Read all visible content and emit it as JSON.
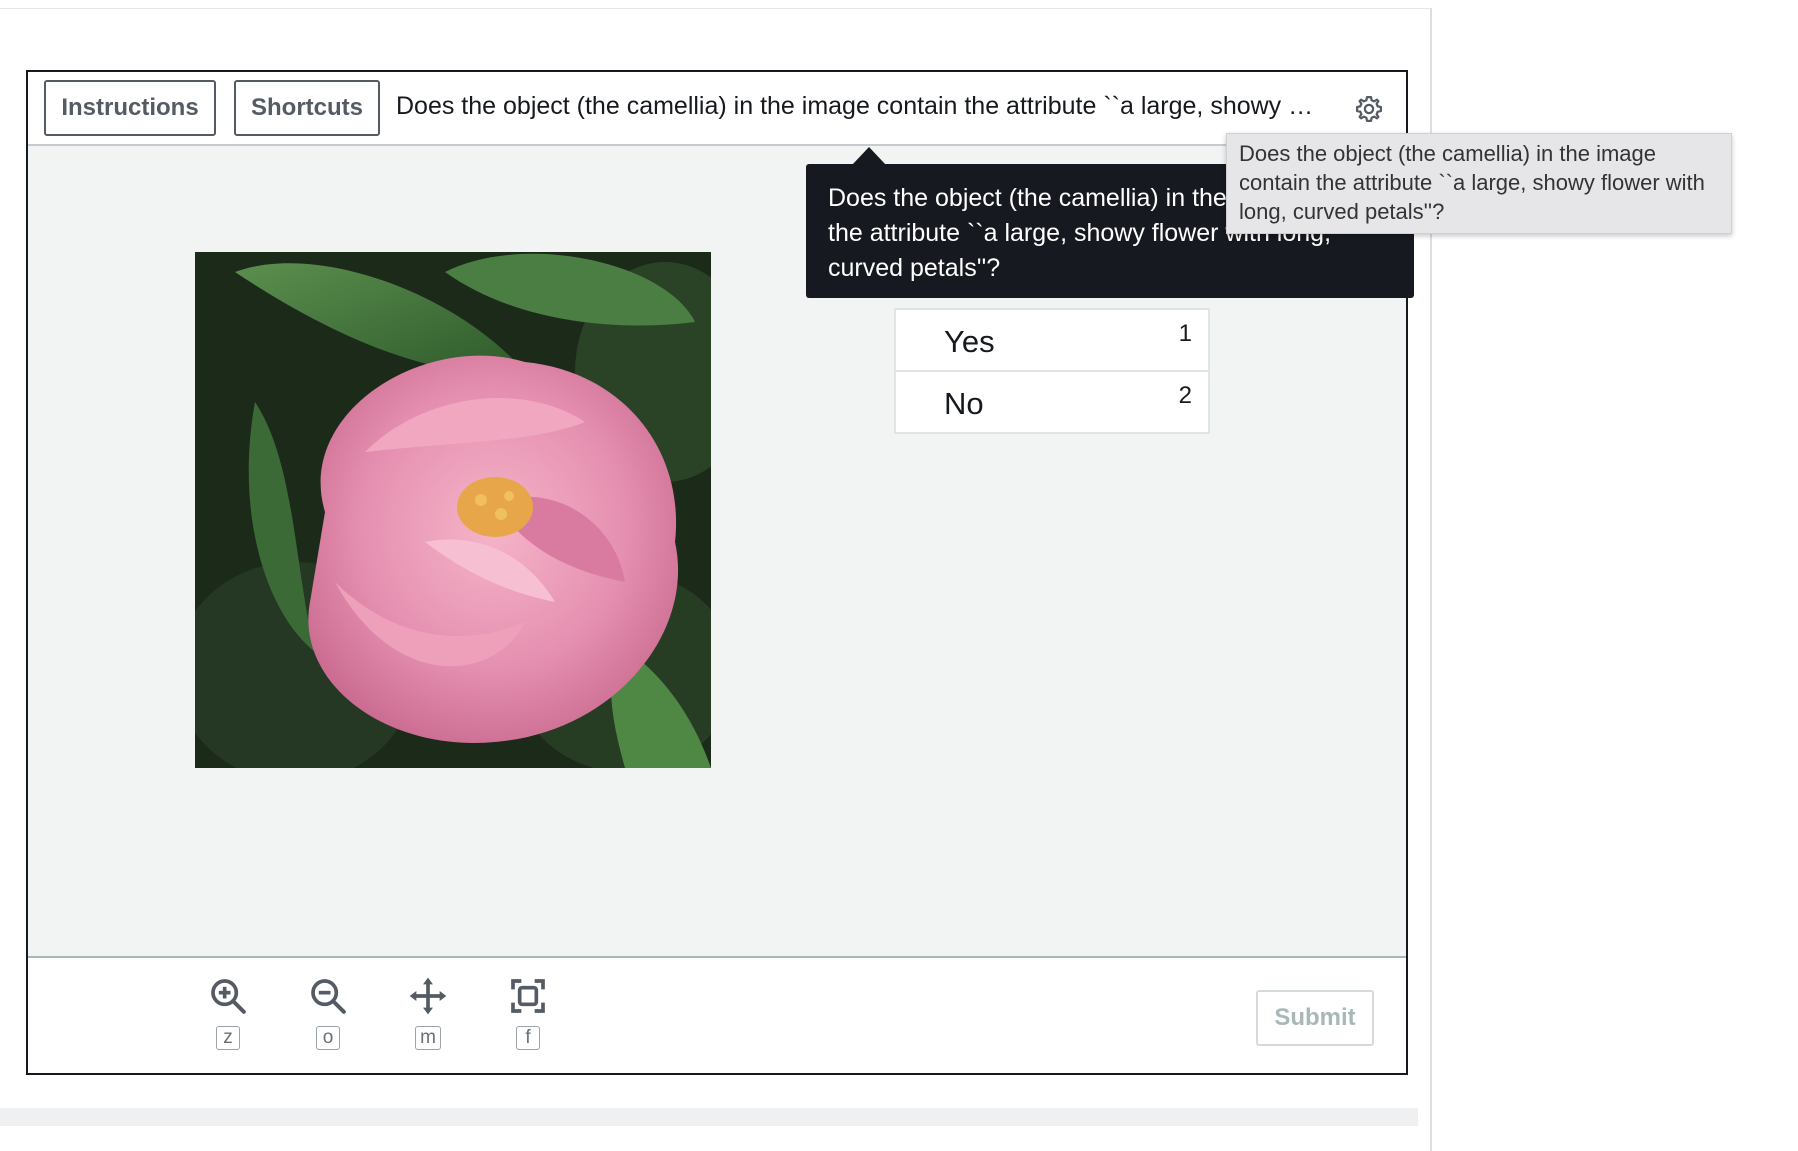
{
  "header": {
    "instructions_label": "Instructions",
    "shortcuts_label": "Shortcuts",
    "question_truncated": "Does the object (the camellia) in the image contain the attribute ``a large, showy …",
    "settings_icon": "gear-icon"
  },
  "tooltip": {
    "question_full": "Does the object (the camellia) in the image contain the attribute ``a large, showy flower with long, curved petals''?"
  },
  "native_tooltip": {
    "text": "Does the object (the camellia) in the image contain the attribute ``a large, showy flower with long, curved petals''?"
  },
  "answers": [
    {
      "label": "Yes",
      "key": "1"
    },
    {
      "label": "No",
      "key": "2"
    }
  ],
  "tools": [
    {
      "icon": "zoom-in-icon",
      "key": "z"
    },
    {
      "icon": "zoom-out-icon",
      "key": "o"
    },
    {
      "icon": "move-icon",
      "key": "m"
    },
    {
      "icon": "fit-screen-icon",
      "key": "f"
    }
  ],
  "footer": {
    "submit_label": "Submit"
  },
  "colors": {
    "frame_border": "#16191f",
    "panel_background": "#f2f3f3",
    "tooltip_background": "#16191f",
    "submit_disabled_text": "#aab7b8",
    "flower_pink": "#e58fb0",
    "leaf_green": "#3f6f3a"
  }
}
